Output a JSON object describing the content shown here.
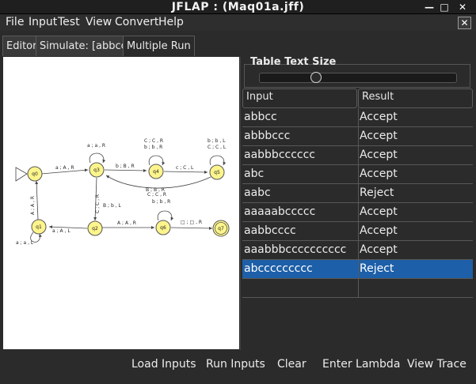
{
  "window": {
    "title": "JFLAP : (Maq01a.jff)",
    "minimize_glyph": "—",
    "maximize_glyph": "□",
    "close_glyph": "✕"
  },
  "menu": {
    "items": [
      "File",
      "Input",
      "Test",
      "View",
      "Convert",
      "Help"
    ],
    "close_glyph": "✕"
  },
  "tabs": [
    "Editor",
    "Simulate: [abbcc]",
    "Multiple Run"
  ],
  "automaton": {
    "states": [
      "q0",
      "q1",
      "q2",
      "q3",
      "q4",
      "q5",
      "q6",
      "q7"
    ],
    "edge_labels": {
      "q0_q3": "a ; A , R",
      "q3_self": "a ; a , R",
      "q3_q4": "b ; B , R",
      "q4_self_1": "C ; C , R",
      "q4_self_2": "b ; b , R",
      "q4_q5": "c ; C , L",
      "q5_self_1": "b ; b , L",
      "q5_self_2": "C ; C , L",
      "q5_q3": "B ; B , R",
      "q3_q2_1": "C ; C , R",
      "q3_q2_2": "B ; b , L",
      "q1_q0": "A ; A , R",
      "q2_q1": "a ; A , L",
      "q2_q6": "A ; A , R",
      "q6_self_1": "C ; C , R",
      "q6_self_2": "b ; b , R",
      "q6_q7": "□ ; □ , R",
      "q1_self": "a ; a , L"
    }
  },
  "table_text_size": {
    "title": "Table Text Size",
    "level": 0.27
  },
  "table": {
    "headers": [
      "Input",
      "Result"
    ],
    "rows": [
      {
        "input": "abbcc",
        "result": "Accept"
      },
      {
        "input": "abbbccc",
        "result": "Accept"
      },
      {
        "input": "aabbbcccccc",
        "result": "Accept"
      },
      {
        "input": "abc",
        "result": "Accept"
      },
      {
        "input": "aabc",
        "result": "Reject"
      },
      {
        "input": "aaaaabccccc",
        "result": "Accept"
      },
      {
        "input": "aabbcccc",
        "result": "Accept"
      },
      {
        "input": "aaabbbcccccccccc",
        "result": "Accept"
      },
      {
        "input": "abccccccccc",
        "result": "Reject"
      },
      {
        "input": "",
        "result": ""
      }
    ],
    "selected_index": 8
  },
  "buttons": {
    "load_inputs": "Load Inputs",
    "run_inputs": "Run Inputs",
    "clear": "Clear",
    "enter_lambda": "Enter Lambda",
    "view_trace": "View Trace"
  }
}
